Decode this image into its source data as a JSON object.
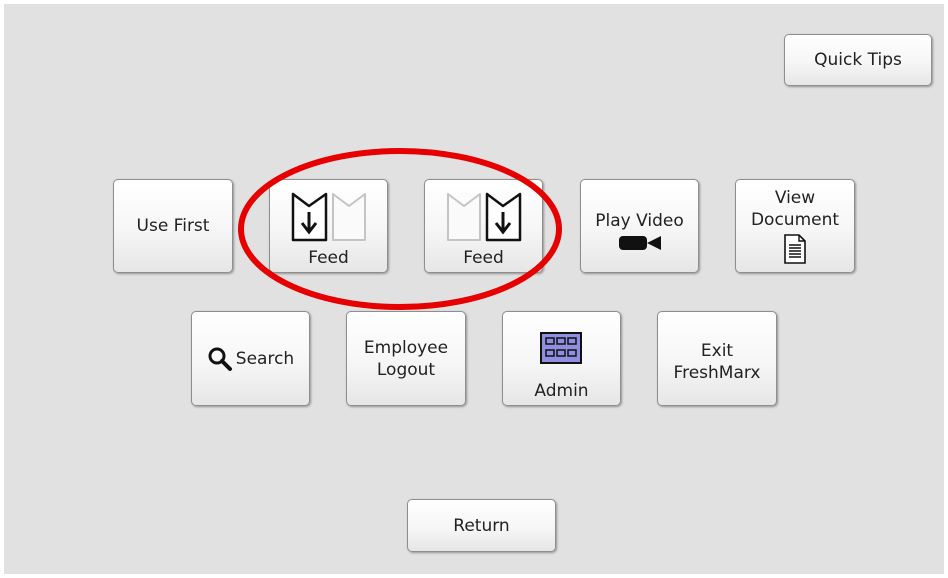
{
  "header": {
    "quick_tips_label": "Quick Tips"
  },
  "row1": {
    "use_first_label": "Use First",
    "feed_left_label": "Feed",
    "feed_right_label": "Feed",
    "play_video_label": "Play Video",
    "view_document_label": "View\nDocument"
  },
  "row2": {
    "search_label": "Search",
    "employee_logout_label": "Employee\nLogout",
    "admin_label": "Admin",
    "exit_label": "Exit\nFreshMarx"
  },
  "footer": {
    "return_label": "Return"
  },
  "colors": {
    "background": "#e1e1e1",
    "annotation_circle": "#e60000",
    "admin_icon": "#8f8ee0"
  },
  "icons": {
    "feed_left": "label-feed-left-icon",
    "feed_right": "label-feed-right-icon",
    "play_video": "video-camera-icon",
    "view_document": "document-icon",
    "search": "magnifier-icon",
    "admin": "grid-panel-icon"
  }
}
